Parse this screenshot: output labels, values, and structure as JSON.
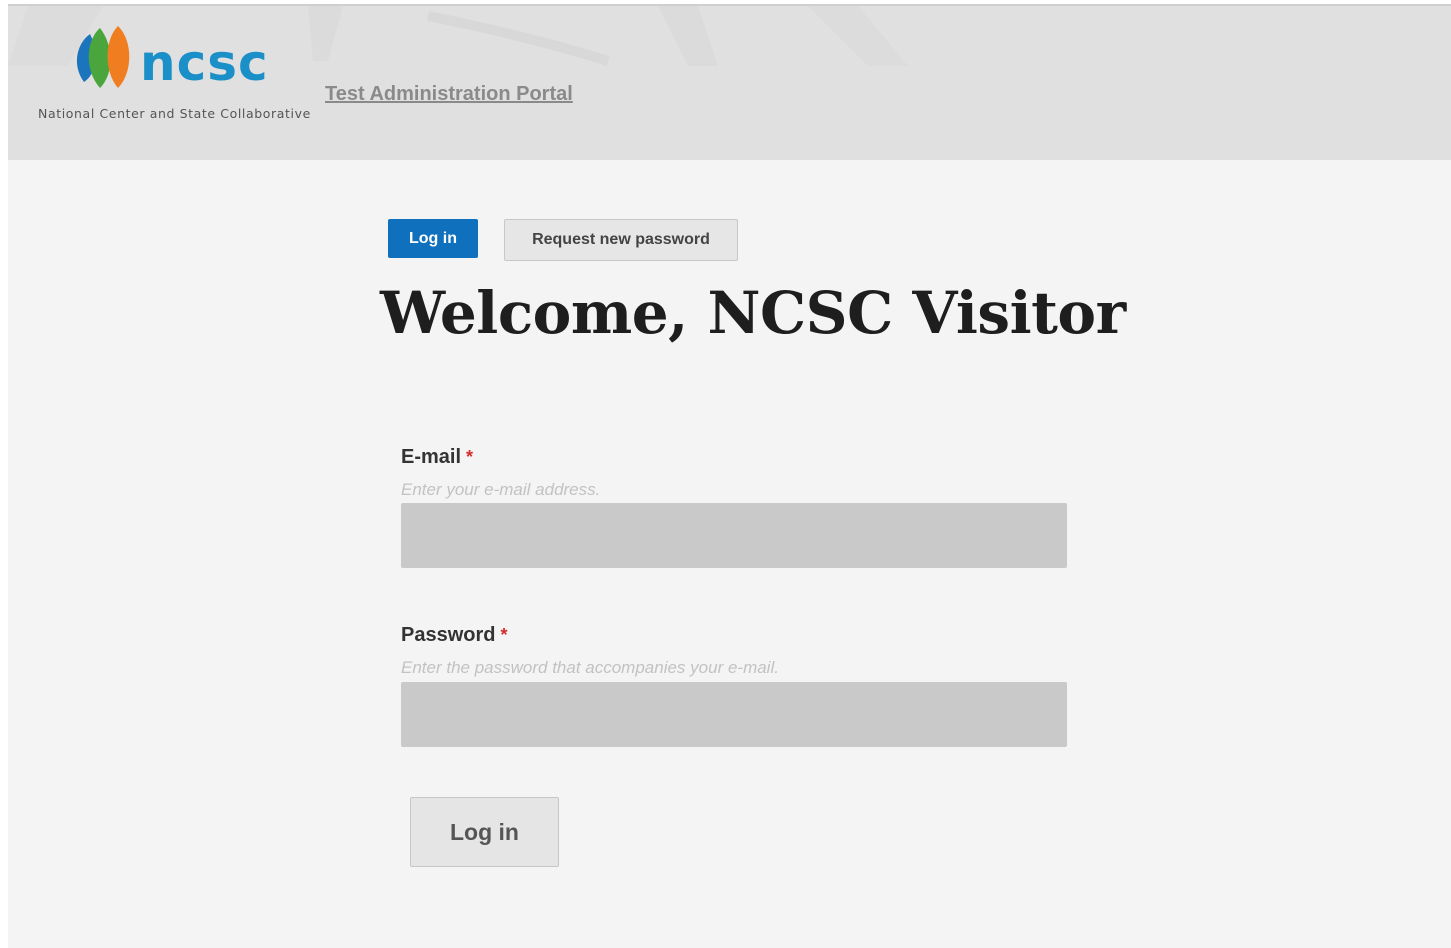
{
  "header": {
    "logo_word": "ncsc",
    "logo_tagline": "National Center and State Collaborative",
    "portal_link": "Test Administration Portal"
  },
  "tabs": {
    "login": "Log in",
    "request_password": "Request new password"
  },
  "page_title": "Welcome, NCSC Visitor",
  "form": {
    "email": {
      "label": "E-mail",
      "required_mark": "*",
      "description": "Enter your e-mail address.",
      "value": ""
    },
    "password": {
      "label": "Password",
      "required_mark": "*",
      "description": "Enter the password that accompanies your e-mail.",
      "value": ""
    },
    "submit_label": "Log in"
  },
  "colors": {
    "brand_blue": "#1b8fc7",
    "active_tab": "#0f71bd",
    "required": "#d42b2b",
    "logo_green": "#4aa63c",
    "logo_orange": "#f07d1f",
    "logo_blue": "#1c75bc"
  }
}
